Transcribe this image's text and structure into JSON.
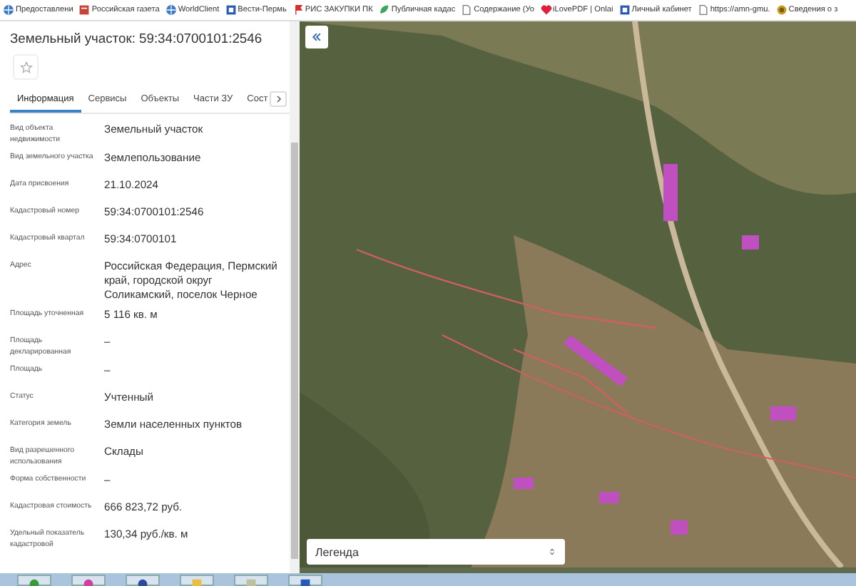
{
  "bookmarks": [
    {
      "label": "Предоставлени"
    },
    {
      "label": "Российская газета"
    },
    {
      "label": "WorldClient"
    },
    {
      "label": "Вести-Пермь"
    },
    {
      "label": "РИС ЗАКУПКИ ПК"
    },
    {
      "label": "Публичная кадас"
    },
    {
      "label": "Содержание (Уо"
    },
    {
      "label": "iLovePDF | Onlai"
    },
    {
      "label": "Личный кабинет"
    },
    {
      "label": "https://amn-gmu."
    },
    {
      "label": "Сведения о з"
    }
  ],
  "panel": {
    "title": "Земельный участок: 59:34:0700101:2546",
    "tabs": [
      {
        "label": "Информация",
        "selected": true
      },
      {
        "label": "Сервисы",
        "selected": false
      },
      {
        "label": "Объекты",
        "selected": false
      },
      {
        "label": "Части ЗУ",
        "selected": false
      },
      {
        "label": "Сост",
        "selected": false
      }
    ],
    "fields": [
      {
        "label": "Вид объекта недвижимости",
        "value": "Земельный участок"
      },
      {
        "label": "Вид земельного участка",
        "value": "Землепользование"
      },
      {
        "label": "Дата присвоения",
        "value": "21.10.2024"
      },
      {
        "label": "Кадастровый номер",
        "value": "59:34:0700101:2546"
      },
      {
        "label": "Кадастровый квартал",
        "value": "59:34:0700101"
      },
      {
        "label": "Адрес",
        "value": "Российская Федерация, Пермский край, городской округ Соликамский, поселок Черное"
      },
      {
        "label": "Площадь уточненная",
        "value": "5 116 кв. м"
      },
      {
        "label": "Площадь декларированная",
        "value": "–"
      },
      {
        "label": "Площадь",
        "value": "–"
      },
      {
        "label": "Статус",
        "value": "Учтенный"
      },
      {
        "label": "Категория земель",
        "value": "Земли населенных пунктов"
      },
      {
        "label": "Вид разрешенного использования",
        "value": "Склады"
      },
      {
        "label": "Форма собственности",
        "value": "–"
      },
      {
        "label": "Кадастровая стоимость",
        "value": "666 823,72 руб."
      },
      {
        "label": "Удельный показатель кадастровой",
        "value": "130,34 руб./кв. м"
      }
    ]
  },
  "map": {
    "legend": {
      "value": "Легенда"
    }
  }
}
